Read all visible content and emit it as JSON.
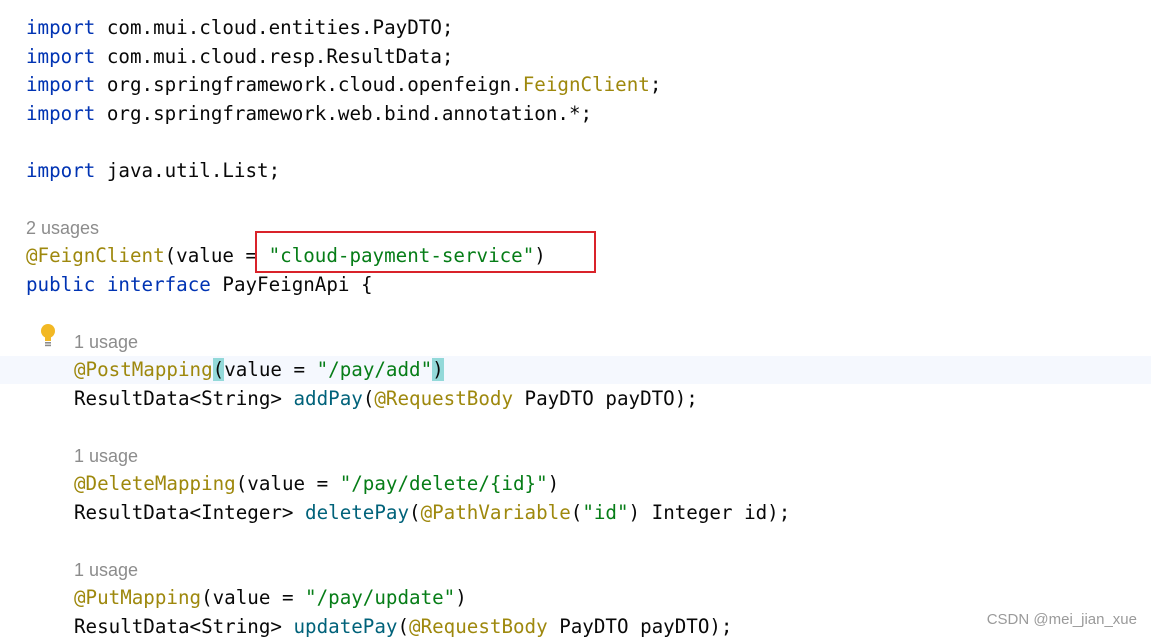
{
  "code": {
    "l1": {
      "kw": "import",
      "rest": " com.mui.cloud.entities.PayDTO;"
    },
    "l2": {
      "kw": "import",
      "rest": " com.mui.cloud.resp.ResultData;"
    },
    "l3": {
      "kw": "import",
      "rest": " org.springframework.cloud.openfeign.",
      "cls": "FeignClient",
      "end": ";"
    },
    "l4": {
      "kw": "import",
      "rest": " org.springframework.web.bind.annotation.*;"
    },
    "l5": {
      "kw": "import",
      "rest": " java.util.List;"
    },
    "usages_class": "2 usages",
    "feign": {
      "ann": "@FeignClient",
      "open": "(value = ",
      "str": "\"cloud-payment-service\"",
      "close": ")"
    },
    "iface": {
      "kw1": "public",
      "kw2": "interface",
      "rest": " PayFeignApi {"
    },
    "usage1": "1 usage",
    "post": {
      "ann": "@PostMapping",
      "paren_open": "(",
      "mid": "value = ",
      "str": "\"/pay/add\"",
      "paren_close": ")"
    },
    "add": {
      "pre": "ResultData<String> ",
      "method": "addPay",
      "open": "(",
      "ann": "@RequestBody",
      "rest": " PayDTO payDTO);"
    },
    "usage2": "1 usage",
    "del": {
      "ann": "@DeleteMapping",
      "mid": "(value = ",
      "str": "\"/pay/delete/{id}\"",
      "close": ")"
    },
    "delpay": {
      "pre": "ResultData<Integer> ",
      "method": "deletePay",
      "open": "(",
      "ann": "@PathVariable",
      "popen": "(",
      "str": "\"id\"",
      "rest": ") Integer id);"
    },
    "usage3": "1 usage",
    "put": {
      "ann": "@PutMapping",
      "mid": "(value = ",
      "str": "\"/pay/update\"",
      "close": ")"
    },
    "upd": {
      "pre": "ResultData<String> ",
      "method": "updatePay",
      "open": "(",
      "ann": "@RequestBody",
      "rest": " PayDTO payDTO);"
    }
  },
  "icons": {
    "bulb": "lightbulb-icon"
  },
  "colors": {
    "keyword": "#0033b3",
    "annotation": "#9e880d",
    "string": "#067d17",
    "method": "#00627a",
    "highlight_box": "#d9232a"
  },
  "watermark": "CSDN @mei_jian_xue"
}
